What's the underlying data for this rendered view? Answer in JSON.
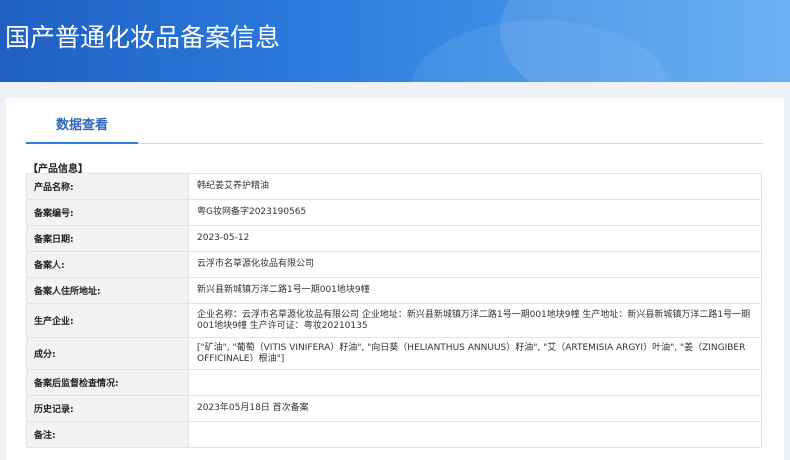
{
  "header": {
    "title": "国产普通化妆品备案信息"
  },
  "tabs": {
    "active_label": "数据查看"
  },
  "section": {
    "label": "【产品信息】"
  },
  "rows": [
    {
      "label": "产品名称:",
      "value": "韩纪姜艾养护精油"
    },
    {
      "label": "备案编号:",
      "value": "粤G妆网备字2023190565"
    },
    {
      "label": "备案日期:",
      "value": "2023-05-12"
    },
    {
      "label": "备案人:",
      "value": "云浮市名草源化妆品有限公司"
    },
    {
      "label": "备案人住所地址:",
      "value": "新兴县新城镇万洋二路1号一期001地块9幢"
    },
    {
      "label": "生产企业:",
      "value": "企业名称：云浮市名草源化妆品有限公司 企业地址：新兴县新城镇万洋二路1号一期001地块9幢 生产地址：新兴县新城镇万洋二路1号一期001地块9幢 生产许可证：粤妆20210135"
    },
    {
      "label": "成分:",
      "value": "[\"矿油\", \"葡萄（VITIS VINIFERA）籽油\", \"向日葵（HELIANTHUS ANNUUS）籽油\", \"艾（ARTEMISIA ARGYI）叶油\", \"姜（ZINGIBER OFFICINALE）根油\"]"
    },
    {
      "label": "备案后监督检查情况:",
      "value": ""
    },
    {
      "label": "历史记录:",
      "value": "2023年05月18日 首次备案"
    },
    {
      "label": "备注:",
      "value": ""
    }
  ]
}
